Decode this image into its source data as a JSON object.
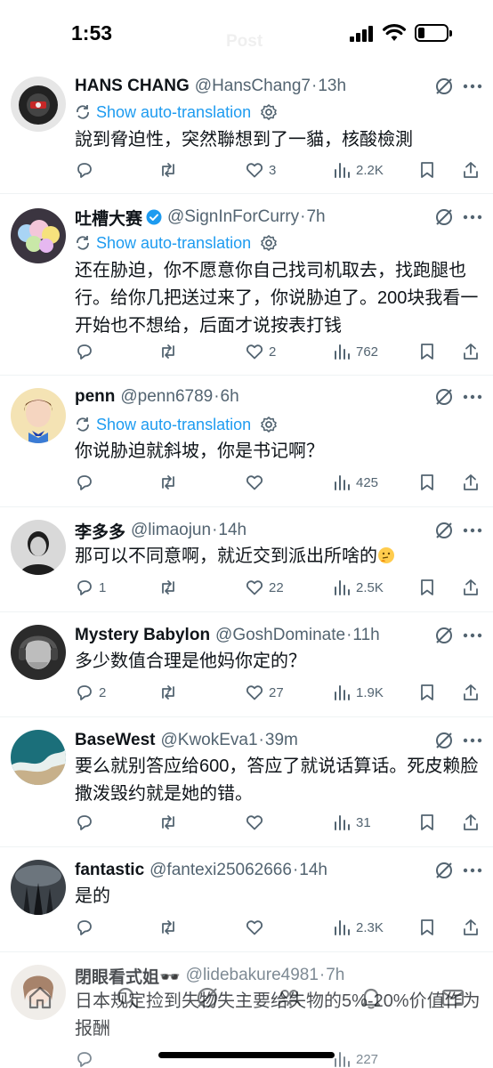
{
  "status_bar": {
    "time": "1:53"
  },
  "header": {
    "title": "Post"
  },
  "tweets": [
    {
      "name": "HANS CHANG",
      "handle": "@HansChang7",
      "time": "13h",
      "verified": false,
      "translation_label": "Show auto-translation",
      "text": "說到脅迫性，突然聯想到了一貓，核酸檢測",
      "replies": "",
      "reposts": "",
      "likes": "3",
      "views": "2.2K"
    },
    {
      "name": "吐槽大赛",
      "handle": "@SignInForCurry",
      "time": "7h",
      "verified": true,
      "translation_label": "Show auto-translation",
      "text": "还在胁迫，你不愿意你自己找司机取去，找跑腿也行。给你几把送过来了，你说胁迫了。200块我看一开始也不想给，后面才说按表打钱",
      "replies": "",
      "reposts": "",
      "likes": "2",
      "views": "762"
    },
    {
      "name": "penn",
      "handle": "@penn6789",
      "time": "6h",
      "verified": false,
      "translation_label": "Show auto-translation",
      "text": "你说胁迫就斜坡，你是书记啊？",
      "replies": "",
      "reposts": "",
      "likes": "",
      "views": "425"
    },
    {
      "name": "李多多",
      "handle": "@limaojun",
      "time": "14h",
      "verified": false,
      "text": "那可以不同意啊，就近交到派出所啥的",
      "replies": "1",
      "reposts": "",
      "likes": "22",
      "views": "2.5K"
    },
    {
      "name": "Mystery Babylon",
      "handle": "@GoshDominate",
      "time": "11h",
      "verified": false,
      "text": "多少数值合理是他妈你定的？",
      "replies": "2",
      "reposts": "",
      "likes": "27",
      "views": "1.9K"
    },
    {
      "name": "BaseWest",
      "handle": "@KwokEva1",
      "time": "39m",
      "verified": false,
      "text": "要么就别答应给600，答应了就说话算话。死皮赖脸撒泼毁约就是她的错。",
      "replies": "",
      "reposts": "",
      "likes": "",
      "views": "31"
    },
    {
      "name": "fantastic",
      "handle": "@fantexi25062666",
      "time": "14h",
      "verified": false,
      "text": "是的",
      "replies": "",
      "reposts": "",
      "likes": "",
      "views": "2.3K"
    },
    {
      "name": "閉眼看式姐🕶️",
      "handle": "@lidebakure4981",
      "time": "7h",
      "verified": false,
      "text": "日本规定捡到失物失主要给失物的5%-20%价值作为报酬",
      "replies": "",
      "reposts": "",
      "likes": "",
      "views": "227"
    }
  ],
  "icons": {
    "reply": "reply-icon",
    "repost": "repost-icon",
    "like": "heart-icon",
    "views": "views-icon",
    "bookmark": "bookmark-icon",
    "share": "share-icon",
    "grok": "grok-icon",
    "more": "more-icon",
    "translate": "translate-icon",
    "gear": "gear-icon"
  },
  "colors": {
    "link": "#1d9bf0",
    "secondary": "#536471",
    "text": "#0f1419",
    "divider": "#eff3f4"
  }
}
